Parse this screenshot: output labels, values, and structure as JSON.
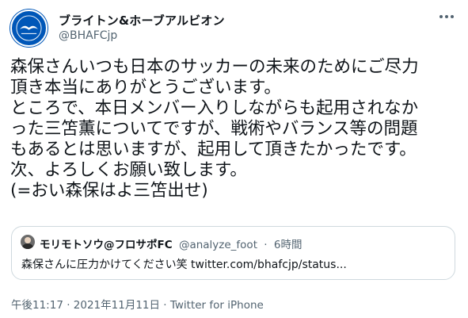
{
  "author": {
    "display_name": "ブライトン&ホーブアルビオン",
    "handle": "@BHAFCjp",
    "avatar_icon": "brighton-seagull-crest"
  },
  "tweet_lines": [
    "森保さんいつも日本のサッカーの未来のためにご尽力",
    "頂き本当にありがとうございます。",
    "ところで、本日メンバー入りしながらも起用されなか",
    "った三笘薫についてですが、戦術やバランス等の問題",
    "もあるとは思いますが、起用して頂きたかったです。",
    "次、よろしくお願い致します。",
    "(=おい森保はよ三笘出せ)"
  ],
  "quote": {
    "name": "モリモトソウ@フロサポFC",
    "handle": "@analyze_foot",
    "separator": "·",
    "time": "6時間",
    "text": "森保さんに圧力かけてください笑 twitter.com/bhafcjp/status..."
  },
  "footer": "午後11:17 · 2021年11月11日 · Twitter for iPhone",
  "colors": {
    "brand_blue": "#0057b8",
    "secondary_text": "#536471",
    "border": "#cfd9de"
  }
}
